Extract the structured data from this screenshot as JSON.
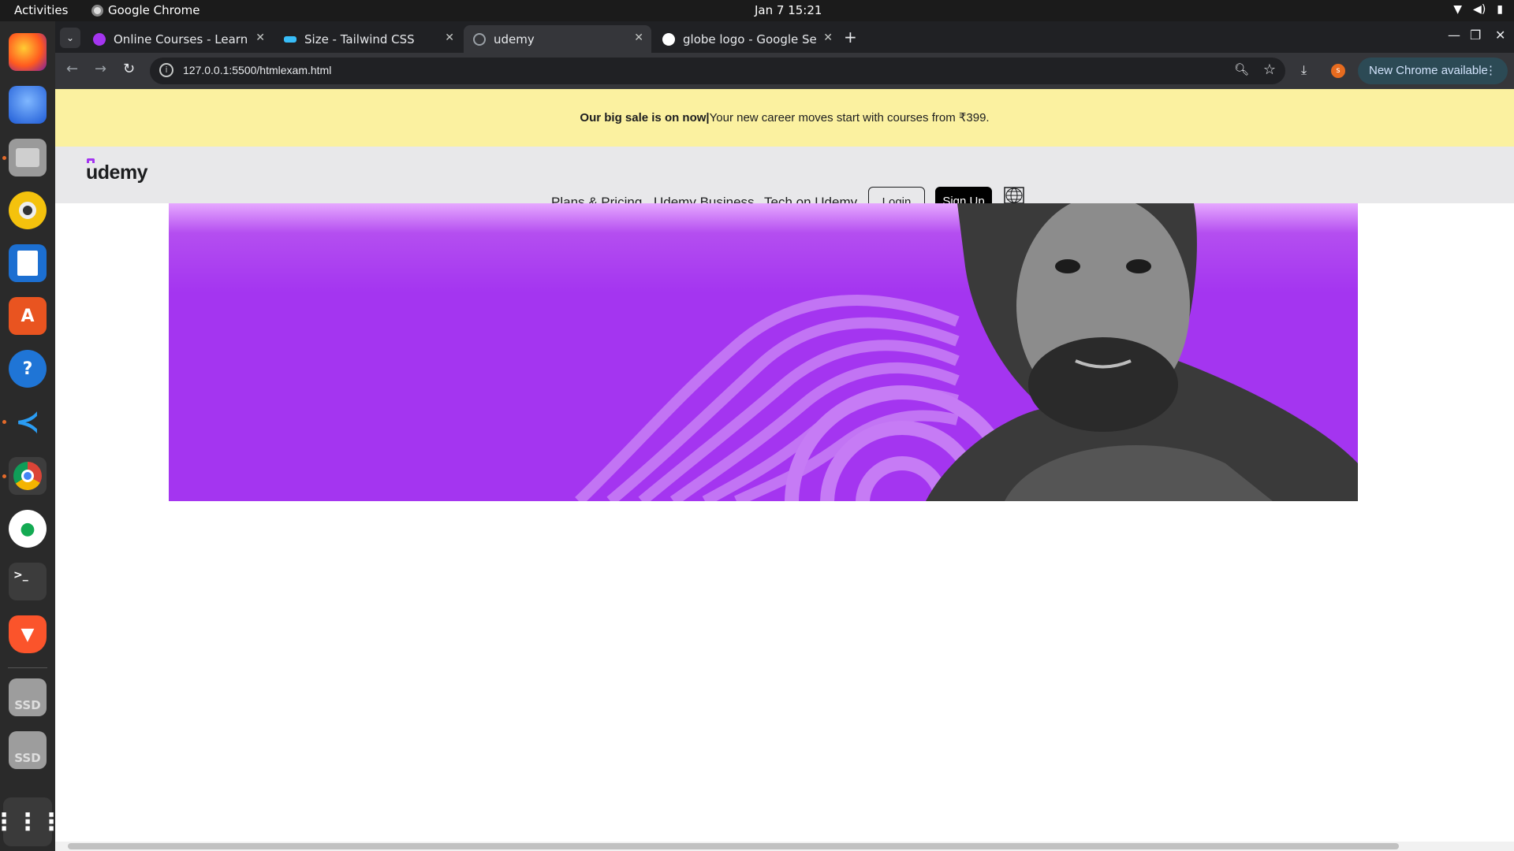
{
  "topbar": {
    "activities": "Activities",
    "app_name": "Google Chrome",
    "clock": "Jan 7  15:21"
  },
  "dock": {
    "items": [
      "firefox-icon",
      "thunderbird-icon",
      "files-icon",
      "rhythmbox-icon",
      "writer-icon",
      "software-icon",
      "help-icon",
      "vscode-icon",
      "chrome-icon",
      "mongodb-icon",
      "terminal-icon",
      "brave-icon",
      "ssd-icon",
      "ssd-icon",
      "app-grid-icon"
    ],
    "ssd_label": "SSD"
  },
  "browser": {
    "tabs": [
      {
        "title": "Online Courses - Learn A",
        "color": "#a435f0"
      },
      {
        "title": "Size - Tailwind CSS",
        "color": "#38bdf8"
      },
      {
        "title": "udemy",
        "color": "#9aa0a6",
        "active": true
      },
      {
        "title": "globe logo - Google Sear",
        "color": "#ffffff"
      }
    ],
    "url": "127.0.0.1:5500/htmlexam.html",
    "update_label": "New Chrome available",
    "avatar_letter": "s"
  },
  "page": {
    "banner_bold": "Our big sale is on now|",
    "banner_text": "Your new career moves start with courses from ₹399.",
    "logo": "udemy",
    "nav": [
      "Plans & Pricing",
      "Udemy Business",
      "Tech on Udemy"
    ],
    "login": "Login",
    "signup": "Sign Up",
    "accent": "#a435f0",
    "banner_color": "#fbf1a0"
  }
}
